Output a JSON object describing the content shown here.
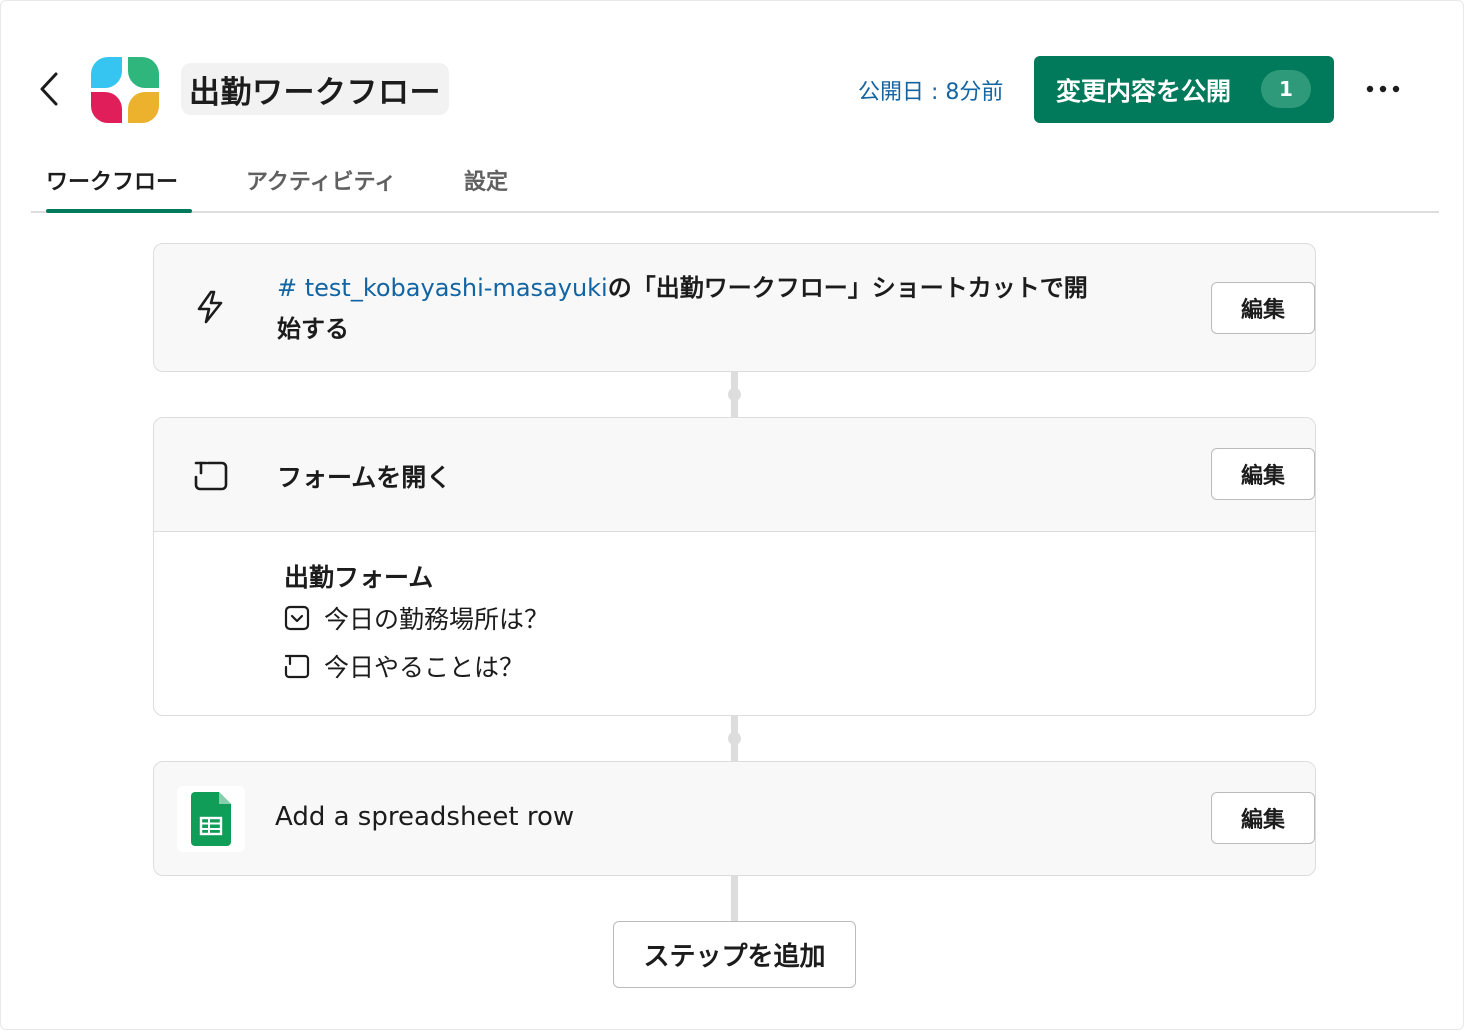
{
  "header": {
    "title": "出勤ワークフロー",
    "published_text": "公開日 : 8分前",
    "publish_button_label": "変更内容を公開",
    "publish_count": "1",
    "icons": {
      "back": "chevron-left-icon",
      "more": "ellipsis-icon",
      "logo": "workflow-logo-icon"
    }
  },
  "tabs": [
    {
      "label": "ワークフロー",
      "active": true
    },
    {
      "label": "アクティビティ",
      "active": false
    },
    {
      "label": "設定",
      "active": false
    }
  ],
  "steps": {
    "trigger": {
      "channel": "# test_kobayashi-masayuki",
      "text": "の「出勤ワークフロー」ショートカットで開始する",
      "edit_label": "編集",
      "icon": "lightning-bolt-icon"
    },
    "form": {
      "title": "フォームを開く",
      "edit_label": "編集",
      "icon": "text-field-icon",
      "form_name": "出勤フォーム",
      "fields": [
        {
          "label": "今日の勤務場所は？",
          "icon": "dropdown-select-icon"
        },
        {
          "label": "今日やることは？",
          "icon": "text-field-icon"
        }
      ]
    },
    "sheets": {
      "title": "Add a spreadsheet row",
      "edit_label": "編集",
      "icon": "google-sheets-icon"
    }
  },
  "add_step_label": "ステップを追加",
  "colors": {
    "accent": "#007a5a",
    "link": "#1264a3",
    "logo_blue": "#36c5f0",
    "logo_green": "#2eb67d",
    "logo_red": "#e01e5a",
    "logo_yellow": "#ecb22e",
    "sheets_green": "#0f9d58"
  }
}
